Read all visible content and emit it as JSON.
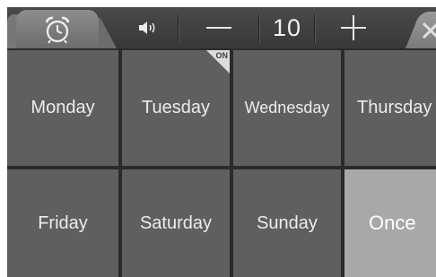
{
  "toolbar": {
    "alarm_tab_icon": "alarm-clock-icon",
    "speaker_icon": "speaker-volume-icon",
    "minus_icon": "minus-icon",
    "volume_value": "10",
    "plus_icon": "plus-icon",
    "close_icon": "close-icon"
  },
  "days": [
    {
      "label": "Monday",
      "on": false,
      "highlighted": false
    },
    {
      "label": "Tuesday",
      "on": true,
      "highlighted": false
    },
    {
      "label": "Wednesday",
      "on": false,
      "highlighted": false
    },
    {
      "label": "Thursday",
      "on": false,
      "highlighted": false
    },
    {
      "label": "Friday",
      "on": false,
      "highlighted": false
    },
    {
      "label": "Saturday",
      "on": false,
      "highlighted": false
    },
    {
      "label": "Sunday",
      "on": false,
      "highlighted": false
    },
    {
      "label": "Once",
      "on": false,
      "highlighted": true
    }
  ],
  "badge": {
    "on_text": "ON"
  },
  "colors": {
    "tile": "#5f5f5f",
    "tile_highlight": "#a8a8a8",
    "toolbar": "#3f3f3f"
  }
}
